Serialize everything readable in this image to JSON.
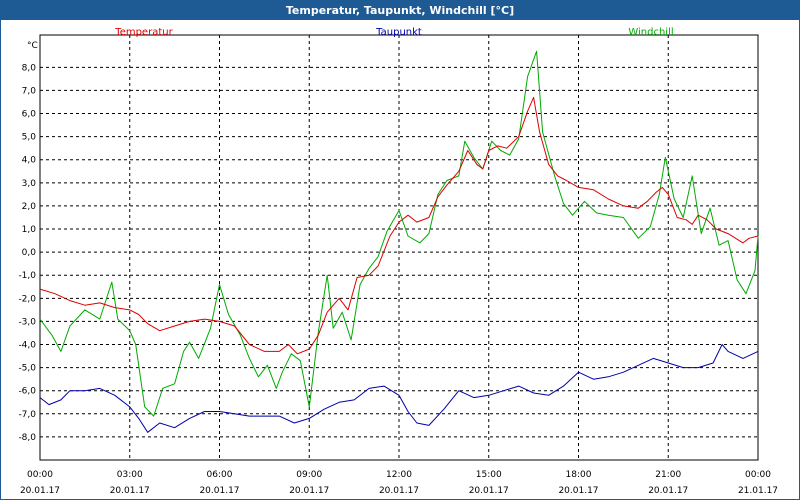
{
  "window": {
    "title": "Temperatur, Taupunkt, Windchill [°C]"
  },
  "colors": {
    "titlebar": "#1e5a93",
    "grid": "#000000"
  },
  "chart_data": {
    "type": "line",
    "title": "Temperatur, Taupunkt, Windchill [°C]",
    "ylabel": "°C",
    "ylim": [
      -9,
      9.4
    ],
    "yticks": [
      -8,
      -7,
      -6,
      -5,
      -4,
      -3,
      -2,
      -1,
      0,
      1,
      2,
      3,
      4,
      5,
      6,
      7,
      8
    ],
    "ytick_labels": [
      "-8,0",
      "-7,0",
      "-6,0",
      "-5,0",
      "-4,0",
      "-3,0",
      "-2,0",
      "-1,0",
      "0,0",
      "1,0",
      "2,0",
      "3,0",
      "4,0",
      "5,0",
      "6,0",
      "7,0",
      "8,0"
    ],
    "xlim": [
      0,
      24
    ],
    "xticks": [
      0,
      3,
      6,
      9,
      12,
      15,
      18,
      21,
      24
    ],
    "xtick_time_labels": [
      "00:00",
      "03:00",
      "06:00",
      "09:00",
      "12:00",
      "15:00",
      "18:00",
      "21:00",
      "00:00"
    ],
    "xtick_date_labels": [
      "20.01.17",
      "20.01.17",
      "20.01.17",
      "20.01.17",
      "20.01.17",
      "20.01.17",
      "20.01.17",
      "20.01.17",
      "21.01.17"
    ],
    "grid": true,
    "legend_position": "top",
    "series": [
      {
        "name": "Temperatur",
        "color": "#dd0000",
        "points": [
          [
            0,
            -1.6
          ],
          [
            0.5,
            -1.8
          ],
          [
            1,
            -2.1
          ],
          [
            1.5,
            -2.3
          ],
          [
            2,
            -2.2
          ],
          [
            2.5,
            -2.4
          ],
          [
            3,
            -2.5
          ],
          [
            3.3,
            -2.7
          ],
          [
            3.6,
            -3.1
          ],
          [
            4,
            -3.4
          ],
          [
            4.5,
            -3.2
          ],
          [
            5,
            -3.0
          ],
          [
            5.5,
            -2.9
          ],
          [
            6,
            -3.0
          ],
          [
            6.5,
            -3.2
          ],
          [
            7,
            -4.0
          ],
          [
            7.5,
            -4.3
          ],
          [
            8,
            -4.3
          ],
          [
            8.3,
            -4.0
          ],
          [
            8.6,
            -4.4
          ],
          [
            9,
            -4.2
          ],
          [
            9.3,
            -3.6
          ],
          [
            9.6,
            -2.6
          ],
          [
            10,
            -2.0
          ],
          [
            10.3,
            -2.5
          ],
          [
            10.6,
            -1.1
          ],
          [
            11,
            -1.0
          ],
          [
            11.3,
            -0.6
          ],
          [
            11.7,
            0.7
          ],
          [
            12,
            1.3
          ],
          [
            12.3,
            1.6
          ],
          [
            12.6,
            1.3
          ],
          [
            13,
            1.5
          ],
          [
            13.3,
            2.4
          ],
          [
            13.6,
            2.9
          ],
          [
            14,
            3.5
          ],
          [
            14.3,
            4.4
          ],
          [
            14.6,
            3.8
          ],
          [
            14.8,
            3.6
          ],
          [
            15,
            4.4
          ],
          [
            15.3,
            4.6
          ],
          [
            15.6,
            4.5
          ],
          [
            16,
            5.0
          ],
          [
            16.3,
            6.1
          ],
          [
            16.5,
            6.7
          ],
          [
            16.7,
            5.2
          ],
          [
            17,
            3.8
          ],
          [
            17.3,
            3.3
          ],
          [
            17.6,
            3.1
          ],
          [
            18,
            2.8
          ],
          [
            18.5,
            2.7
          ],
          [
            19,
            2.3
          ],
          [
            19.5,
            2.0
          ],
          [
            20,
            1.9
          ],
          [
            20.3,
            2.2
          ],
          [
            20.6,
            2.6
          ],
          [
            20.8,
            2.8
          ],
          [
            21,
            2.5
          ],
          [
            21.3,
            1.5
          ],
          [
            21.6,
            1.4
          ],
          [
            21.8,
            1.2
          ],
          [
            22,
            1.6
          ],
          [
            22.3,
            1.4
          ],
          [
            22.6,
            1.0
          ],
          [
            23,
            0.8
          ],
          [
            23.5,
            0.4
          ],
          [
            23.7,
            0.6
          ],
          [
            24,
            0.7
          ]
        ]
      },
      {
        "name": "Taupunkt",
        "color": "#0000aa",
        "points": [
          [
            0,
            -6.3
          ],
          [
            0.3,
            -6.6
          ],
          [
            0.7,
            -6.4
          ],
          [
            1,
            -6.0
          ],
          [
            1.5,
            -6.0
          ],
          [
            2,
            -5.9
          ],
          [
            2.5,
            -6.2
          ],
          [
            3,
            -6.7
          ],
          [
            3.3,
            -7.2
          ],
          [
            3.6,
            -7.8
          ],
          [
            4,
            -7.4
          ],
          [
            4.5,
            -7.6
          ],
          [
            5,
            -7.2
          ],
          [
            5.5,
            -6.9
          ],
          [
            6,
            -6.9
          ],
          [
            6.5,
            -7.0
          ],
          [
            7,
            -7.1
          ],
          [
            7.5,
            -7.1
          ],
          [
            8,
            -7.1
          ],
          [
            8.5,
            -7.4
          ],
          [
            9,
            -7.2
          ],
          [
            9.5,
            -6.8
          ],
          [
            10,
            -6.5
          ],
          [
            10.5,
            -6.4
          ],
          [
            11,
            -5.9
          ],
          [
            11.5,
            -5.8
          ],
          [
            12,
            -6.2
          ],
          [
            12.3,
            -6.9
          ],
          [
            12.6,
            -7.4
          ],
          [
            13,
            -7.5
          ],
          [
            13.5,
            -6.8
          ],
          [
            14,
            -6.0
          ],
          [
            14.5,
            -6.3
          ],
          [
            15,
            -6.2
          ],
          [
            15.5,
            -6.0
          ],
          [
            16,
            -5.8
          ],
          [
            16.5,
            -6.1
          ],
          [
            17,
            -6.2
          ],
          [
            17.5,
            -5.8
          ],
          [
            18,
            -5.2
          ],
          [
            18.5,
            -5.5
          ],
          [
            19,
            -5.4
          ],
          [
            19.5,
            -5.2
          ],
          [
            20,
            -4.9
          ],
          [
            20.5,
            -4.6
          ],
          [
            21,
            -4.8
          ],
          [
            21.5,
            -5.0
          ],
          [
            22,
            -5.0
          ],
          [
            22.5,
            -4.8
          ],
          [
            22.8,
            -4.0
          ],
          [
            23,
            -4.3
          ],
          [
            23.5,
            -4.6
          ],
          [
            24,
            -4.3
          ]
        ]
      },
      {
        "name": "Windchill",
        "color": "#00aa00",
        "points": [
          [
            0,
            -2.9
          ],
          [
            0.4,
            -3.6
          ],
          [
            0.7,
            -4.3
          ],
          [
            1,
            -3.2
          ],
          [
            1.5,
            -2.5
          ],
          [
            2,
            -2.9
          ],
          [
            2.4,
            -1.3
          ],
          [
            2.6,
            -2.9
          ],
          [
            3,
            -3.4
          ],
          [
            3.2,
            -4.0
          ],
          [
            3.5,
            -6.7
          ],
          [
            3.8,
            -7.1
          ],
          [
            4.1,
            -5.9
          ],
          [
            4.5,
            -5.7
          ],
          [
            4.8,
            -4.3
          ],
          [
            5,
            -3.9
          ],
          [
            5.3,
            -4.6
          ],
          [
            5.7,
            -3.3
          ],
          [
            6,
            -1.4
          ],
          [
            6.3,
            -2.7
          ],
          [
            6.7,
            -3.6
          ],
          [
            7,
            -4.6
          ],
          [
            7.3,
            -5.4
          ],
          [
            7.6,
            -4.9
          ],
          [
            7.9,
            -5.9
          ],
          [
            8.1,
            -5.2
          ],
          [
            8.4,
            -4.4
          ],
          [
            8.7,
            -4.7
          ],
          [
            9,
            -6.7
          ],
          [
            9.3,
            -3.5
          ],
          [
            9.6,
            -1.0
          ],
          [
            9.8,
            -3.3
          ],
          [
            10.1,
            -2.6
          ],
          [
            10.4,
            -3.8
          ],
          [
            10.7,
            -1.4
          ],
          [
            11,
            -0.7
          ],
          [
            11.3,
            -0.2
          ],
          [
            11.6,
            0.9
          ],
          [
            12,
            1.8
          ],
          [
            12.3,
            0.7
          ],
          [
            12.7,
            0.4
          ],
          [
            13,
            0.8
          ],
          [
            13.3,
            2.5
          ],
          [
            13.6,
            3.1
          ],
          [
            14,
            3.3
          ],
          [
            14.2,
            4.8
          ],
          [
            14.5,
            4.1
          ],
          [
            14.8,
            3.6
          ],
          [
            15.1,
            4.8
          ],
          [
            15.4,
            4.4
          ],
          [
            15.7,
            4.2
          ],
          [
            16,
            4.9
          ],
          [
            16.3,
            7.6
          ],
          [
            16.6,
            8.7
          ],
          [
            16.8,
            5.2
          ],
          [
            17.2,
            3.3
          ],
          [
            17.5,
            2.1
          ],
          [
            17.8,
            1.6
          ],
          [
            18.2,
            2.2
          ],
          [
            18.6,
            1.7
          ],
          [
            19,
            1.6
          ],
          [
            19.5,
            1.5
          ],
          [
            20,
            0.6
          ],
          [
            20.4,
            1.1
          ],
          [
            20.7,
            2.5
          ],
          [
            20.9,
            4.1
          ],
          [
            21.2,
            2.3
          ],
          [
            21.5,
            1.5
          ],
          [
            21.8,
            3.3
          ],
          [
            22.1,
            0.8
          ],
          [
            22.4,
            1.9
          ],
          [
            22.7,
            0.3
          ],
          [
            23,
            0.5
          ],
          [
            23.3,
            -1.2
          ],
          [
            23.6,
            -1.8
          ],
          [
            23.9,
            -0.8
          ],
          [
            24,
            0.7
          ]
        ]
      }
    ]
  }
}
